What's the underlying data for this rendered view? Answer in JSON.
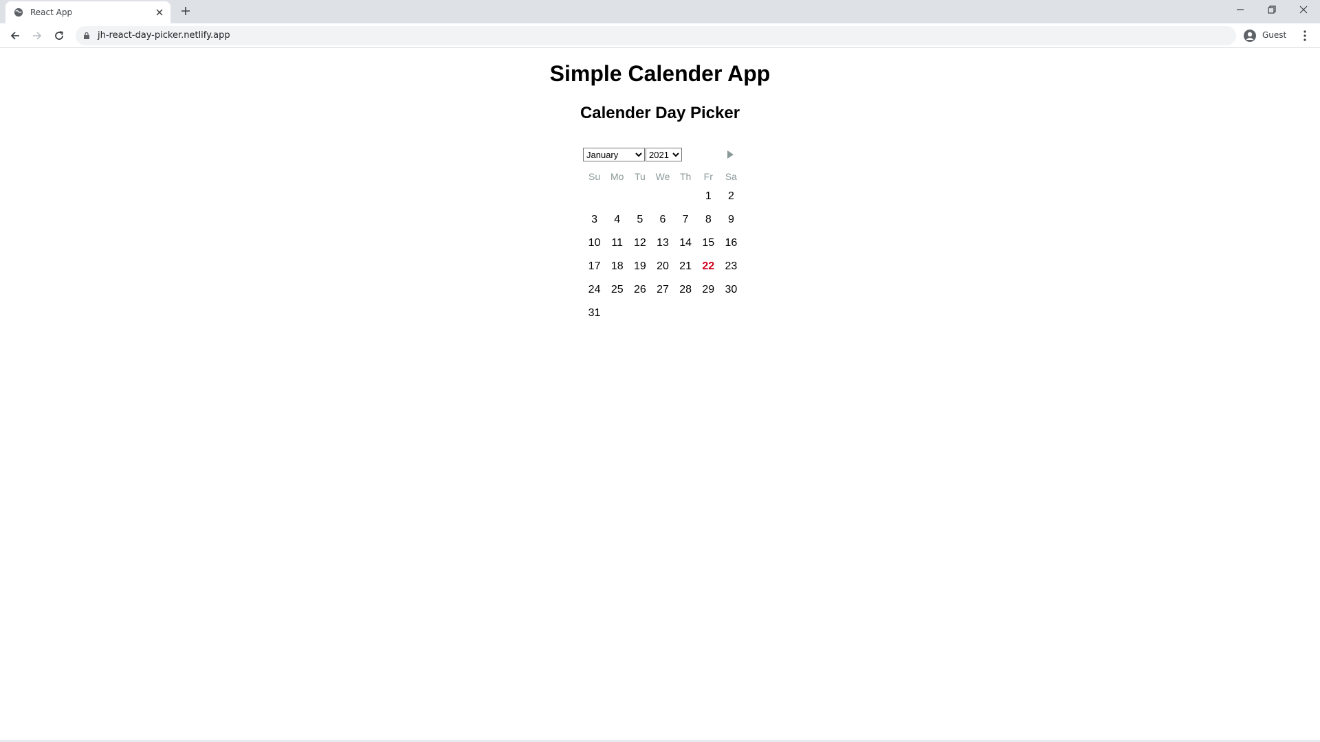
{
  "browser": {
    "tab_title": "React App",
    "url": "jh-react-day-picker.netlify.app",
    "profile_label": "Guest"
  },
  "page": {
    "title": "Simple Calender App",
    "subtitle": "Calender Day Picker"
  },
  "calendar": {
    "month_selected": "January",
    "year_selected": "2021",
    "weekdays": [
      "Su",
      "Mo",
      "Tu",
      "We",
      "Th",
      "Fr",
      "Sa"
    ],
    "weeks": [
      [
        "",
        "",
        "",
        "",
        "",
        "1",
        "2"
      ],
      [
        "3",
        "4",
        "5",
        "6",
        "7",
        "8",
        "9"
      ],
      [
        "10",
        "11",
        "12",
        "13",
        "14",
        "15",
        "16"
      ],
      [
        "17",
        "18",
        "19",
        "20",
        "21",
        "22",
        "23"
      ],
      [
        "24",
        "25",
        "26",
        "27",
        "28",
        "29",
        "30"
      ],
      [
        "31",
        "",
        "",
        "",
        "",
        "",
        ""
      ]
    ],
    "today": "22",
    "today_color": "#d0021b"
  }
}
